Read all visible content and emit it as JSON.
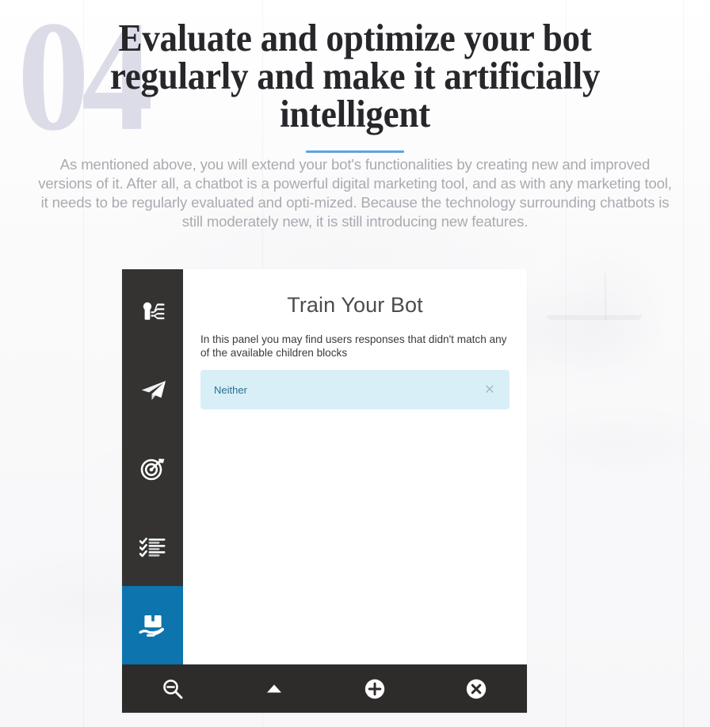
{
  "section": {
    "watermark_number": "04",
    "title": "Evaluate and optimize your bot regularly and make it artificially intelligent",
    "paragraph": "As mentioned above, you will extend your bot's functionalities by creating new and improved versions of it. After all, a chatbot is a powerful digital marketing tool, and as with any marketing tool, it needs to be regularly evaluated and opti-mized. Because the technology surrounding chatbots is still moderately new, it is still introducing new features.",
    "accent_color": "#5ba5e0",
    "watermark_color": "#dcdce9"
  },
  "app": {
    "sidebar": {
      "background_color": "#353331",
      "active_color": "#0d74ad",
      "items": [
        {
          "name": "flow-builder",
          "icon": "flow-branch-icon",
          "active": false
        },
        {
          "name": "broadcast",
          "icon": "paper-plane-icon",
          "active": false
        },
        {
          "name": "goals",
          "icon": "target-icon",
          "active": false
        },
        {
          "name": "tasks",
          "icon": "checklist-icon",
          "active": false
        },
        {
          "name": "train-bot",
          "icon": "hand-book-icon",
          "active": true
        }
      ]
    },
    "panel": {
      "title": "Train Your Bot",
      "description": "In this panel you may find users responses that didn't match any of the available children blocks",
      "responses": [
        {
          "label": "Neither",
          "dismiss": "×"
        }
      ],
      "alert_background": "#d9eff8",
      "alert_text_color": "#29708c"
    },
    "toolbar": {
      "background_color": "#2e2c2b",
      "buttons": [
        {
          "name": "zoom-out",
          "icon": "magnifier-minus-icon",
          "label": "Zoom out"
        },
        {
          "name": "collapse",
          "icon": "caret-up-icon",
          "label": "Collapse"
        },
        {
          "name": "add",
          "icon": "plus-circle-icon",
          "label": "Add"
        },
        {
          "name": "close",
          "icon": "x-circle-icon",
          "label": "Close"
        }
      ]
    }
  }
}
